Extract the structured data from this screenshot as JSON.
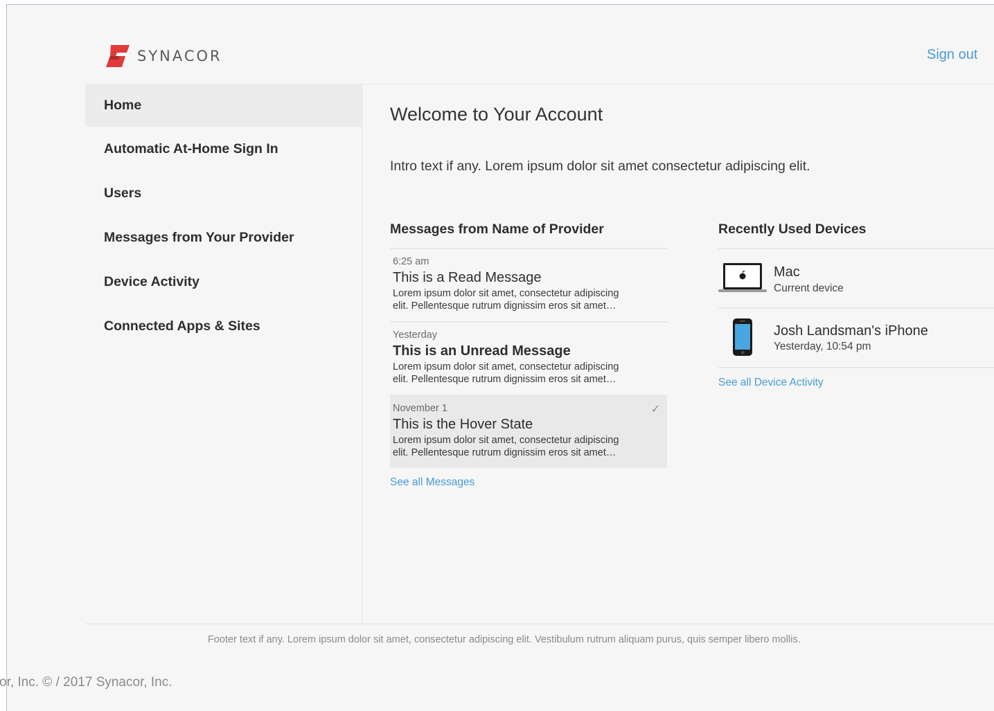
{
  "brand": {
    "name": "SYNACOR",
    "color": "#e03a3a"
  },
  "header": {
    "sign_out": "Sign out"
  },
  "sidebar": {
    "items": [
      {
        "label": "Home",
        "active": true
      },
      {
        "label": "Automatic At-Home Sign In",
        "active": false
      },
      {
        "label": "Users",
        "active": false
      },
      {
        "label": "Messages from Your Provider",
        "active": false
      },
      {
        "label": "Device Activity",
        "active": false
      },
      {
        "label": "Connected Apps & Sites",
        "active": false
      }
    ]
  },
  "main": {
    "title": "Welcome to Your Account",
    "intro": "Intro text if any. Lorem ipsum dolor sit amet consectetur adipiscing elit."
  },
  "messages": {
    "heading": "Messages from Name of Provider",
    "items": [
      {
        "time": "6:25 am",
        "title": "This is a Read Message",
        "body_line1": "Lorem ipsum dolor sit amet, consectetur adipiscing",
        "body_line2": "elit. Pellentesque rutrum dignissim eros sit amet…"
      },
      {
        "time": "Yesterday",
        "title": "This is an Unread Message",
        "body_line1": "Lorem ipsum dolor sit amet, consectetur adipiscing",
        "body_line2": "elit. Pellentesque rutrum dignissim eros sit amet…"
      },
      {
        "time": "November 1",
        "title": "This is the Hover State",
        "body_line1": "Lorem ipsum dolor sit amet, consectetur adipiscing",
        "body_line2": "elit. Pellentesque rutrum dignissim eros sit amet…"
      }
    ],
    "check_glyph": "✓",
    "see_all": "See all Messages"
  },
  "devices": {
    "heading": "Recently Used Devices",
    "items": [
      {
        "name": "Mac",
        "detail": "Current device",
        "icon": "laptop-icon"
      },
      {
        "name": "Josh Landsman's iPhone",
        "detail": "Yesterday, 10:54 pm",
        "icon": "phone-icon"
      }
    ],
    "see_all": "See all Device Activity"
  },
  "footer": {
    "text": "Footer text if any. Lorem ipsum dolor sit amet, consectetur adipiscing elit. Vestibulum rutrum aliquam purus, quis semper libero mollis.",
    "copyright": "or, Inc. © / 2017 Synacor, Inc."
  },
  "colors": {
    "link": "#4a9ad6",
    "active_nav_bg": "#ececec",
    "page_bg": "#f6f6f6"
  }
}
